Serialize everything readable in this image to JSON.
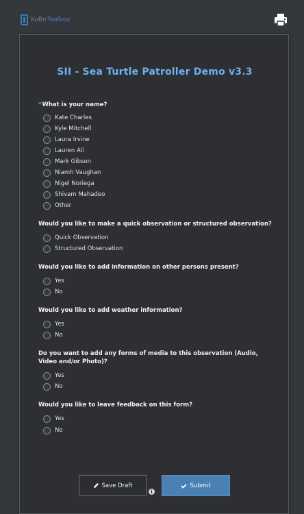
{
  "header": {
    "logo_kobo": "KoBo",
    "logo_toolbox": "Toolbox"
  },
  "form": {
    "title": "SII - Sea Turtle Patroller Demo v3.3",
    "questions": [
      {
        "label": "What is your name?",
        "required": "*",
        "options": [
          "Kate Charles",
          "Kyle Mitchell",
          "Laura Irvine",
          "Lauren Ali",
          "Mark Gibson",
          "Niamh Vaughan",
          "Nigel Noriega",
          "Shivam Mahadeo",
          "Other"
        ]
      },
      {
        "label": "Would you like to make a quick observation or structured observation?",
        "options": [
          "Quick Observation",
          "Structured Observation"
        ]
      },
      {
        "label": "Would you like to add information on other persons present?",
        "options": [
          "Yes",
          "No"
        ]
      },
      {
        "label": "Would you like to add weather information?",
        "options": [
          "Yes",
          "No"
        ]
      },
      {
        "label": "Do you want to add any forms of media to this observation (Audio, Video and/or Photo)?",
        "options": [
          "Yes",
          "No"
        ]
      },
      {
        "label": "Would you like to leave feedback on this form?",
        "options": [
          "Yes",
          "No"
        ]
      }
    ]
  },
  "buttons": {
    "save_draft": "Save Draft",
    "submit": "Submit"
  },
  "icons": {
    "print": "print-icon",
    "info": "info-icon",
    "pencil": "pencil-icon",
    "check": "check-icon"
  },
  "colors": {
    "title": "#6eb0f2",
    "submit_bg": "#4a80b4",
    "required": "#5aa2e6"
  }
}
